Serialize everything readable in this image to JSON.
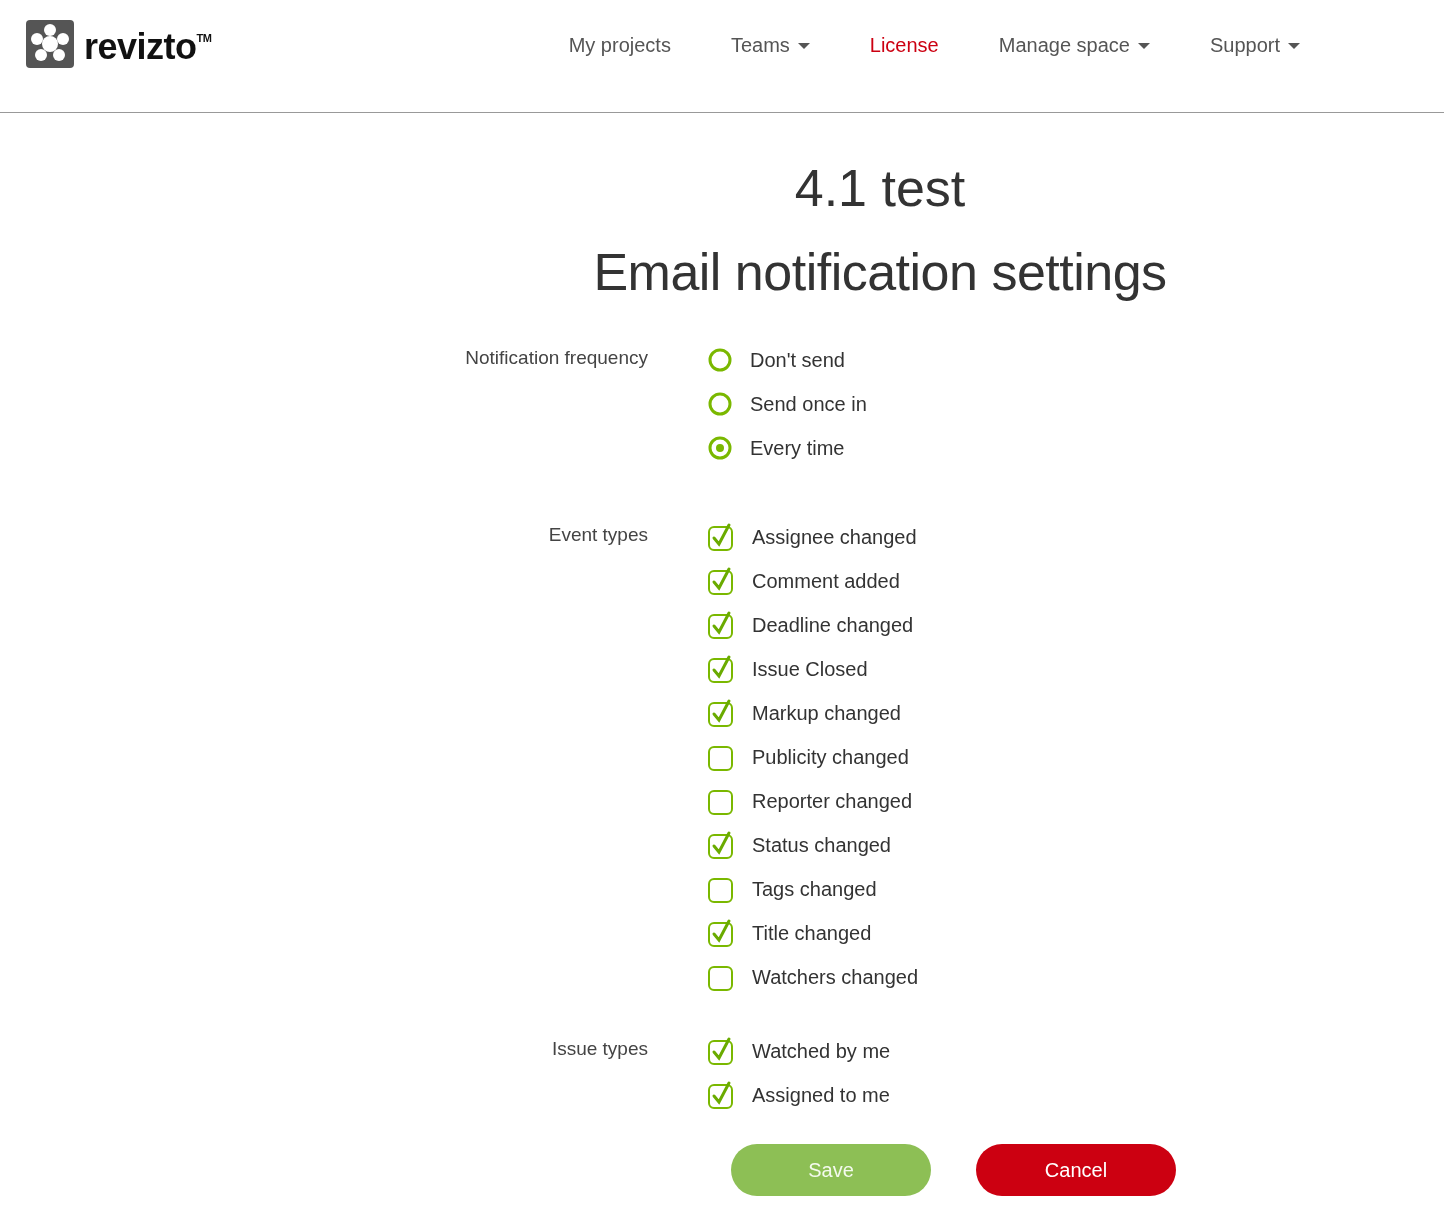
{
  "logo": {
    "text": "revizto",
    "mark": "TM"
  },
  "nav": [
    {
      "label": "My projects",
      "selected": false,
      "has_menu": false
    },
    {
      "label": "Teams",
      "selected": false,
      "has_menu": true
    },
    {
      "label": "License",
      "selected": true,
      "has_menu": false
    },
    {
      "label": "Manage space",
      "selected": false,
      "has_menu": true
    },
    {
      "label": "Support",
      "selected": false,
      "has_menu": true
    }
  ],
  "project_title": "4.1 test",
  "page_title": "Email notification settings",
  "sections": [
    {
      "label": "Notification frequency",
      "kind": "radio",
      "options": [
        {
          "label": "Don't send",
          "selected": false
        },
        {
          "label": "Send once in",
          "selected": false
        },
        {
          "label": "Every time",
          "selected": true
        }
      ]
    },
    {
      "label": "Event types",
      "kind": "checkbox",
      "options": [
        {
          "label": "Assignee changed",
          "checked": true
        },
        {
          "label": "Comment added",
          "checked": true
        },
        {
          "label": "Deadline changed",
          "checked": true
        },
        {
          "label": "Issue Closed",
          "checked": true
        },
        {
          "label": "Markup changed",
          "checked": true
        },
        {
          "label": "Publicity changed",
          "checked": false
        },
        {
          "label": "Reporter changed",
          "checked": false
        },
        {
          "label": "Status changed",
          "checked": true
        },
        {
          "label": "Tags changed",
          "checked": false
        },
        {
          "label": "Title changed",
          "checked": true
        },
        {
          "label": "Watchers changed",
          "checked": false
        }
      ]
    },
    {
      "label": "Issue types",
      "kind": "checkbox",
      "options": [
        {
          "label": "Watched by me",
          "checked": true
        },
        {
          "label": "Assigned to me",
          "checked": true
        }
      ]
    }
  ],
  "buttons": [
    {
      "label": "Save",
      "kind": "save",
      "disabled": true
    },
    {
      "label": "Cancel",
      "kind": "cancel",
      "disabled": false
    }
  ]
}
